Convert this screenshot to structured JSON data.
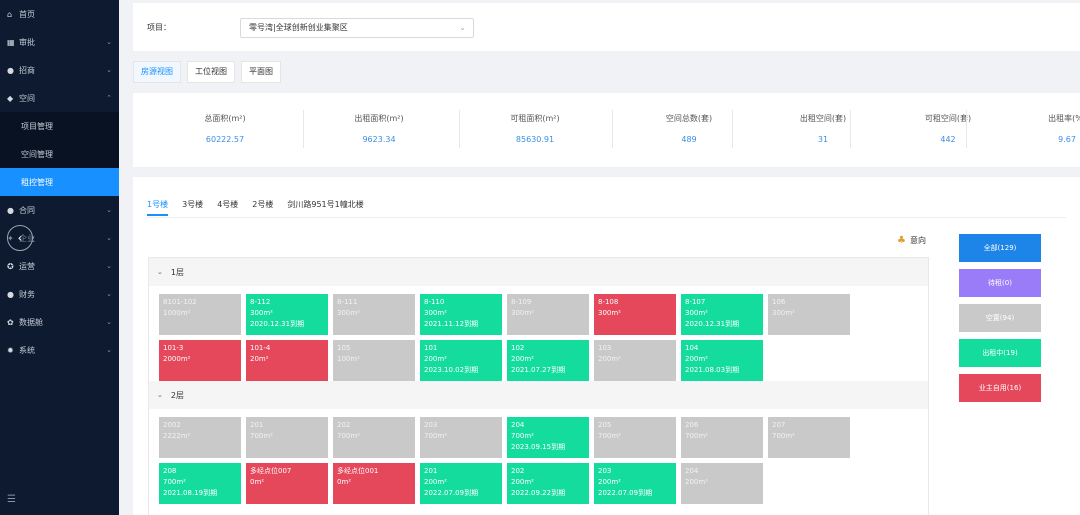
{
  "sidebar": {
    "items": [
      {
        "icon": "home-icon",
        "glyph": "⌂",
        "label": "首页",
        "chev": ""
      },
      {
        "icon": "approval-icon",
        "glyph": "▦",
        "label": "审批",
        "chev": "⌄"
      },
      {
        "icon": "person-icon",
        "glyph": "●",
        "label": "招商",
        "chev": "⌄"
      },
      {
        "icon": "cube-icon",
        "glyph": "◆",
        "label": "空间",
        "chev": "⌃"
      }
    ],
    "subitems": [
      {
        "label": "项目管理",
        "active": false
      },
      {
        "label": "空间管理",
        "active": false
      },
      {
        "label": "租控管理",
        "active": true
      }
    ],
    "items2": [
      {
        "icon": "contract-icon",
        "glyph": "●",
        "label": "合同",
        "chev": "⌄"
      },
      {
        "icon": "enterprise-icon",
        "glyph": "✦",
        "label": "企业",
        "chev": "⌄"
      },
      {
        "icon": "operation-icon",
        "glyph": "✪",
        "label": "运营",
        "chev": "⌄"
      },
      {
        "icon": "finance-icon",
        "glyph": "●",
        "label": "财务",
        "chev": "⌄"
      },
      {
        "icon": "data-icon",
        "glyph": "✿",
        "label": "数据舱",
        "chev": "⌄"
      },
      {
        "icon": "system-icon",
        "glyph": "✹",
        "label": "系统",
        "chev": "⌄"
      }
    ],
    "collapse_glyph": "‹",
    "footer_glyph": "☰"
  },
  "project": {
    "label": "项目：",
    "value": "零号湾|全球创新创业集聚区",
    "arrow": "⌄"
  },
  "view_tabs": [
    {
      "label": "房源视图",
      "active": true
    },
    {
      "label": "工位视图",
      "active": false
    },
    {
      "label": "平面图",
      "active": false
    }
  ],
  "stats": [
    {
      "title": "总面积(m²)",
      "value": "60222.57"
    },
    {
      "title": "出租面积(m²)",
      "value": "9623.34"
    },
    {
      "title": "可租面积(m²)",
      "value": "85630.91"
    },
    {
      "title": "空间总数(套)",
      "value": "489"
    },
    {
      "title": "出租空间(套)",
      "value": "31"
    },
    {
      "title": "可租空间(套)",
      "value": "442"
    },
    {
      "title": "出租率(%)",
      "value": "9.67"
    }
  ],
  "building_tabs": [
    {
      "label": "1号楼",
      "active": true
    },
    {
      "label": "3号楼",
      "active": false
    },
    {
      "label": "4号楼",
      "active": false
    },
    {
      "label": "2号楼",
      "active": false
    },
    {
      "label": "剑川路951号1幢北楼",
      "active": false
    }
  ],
  "legend": {
    "icon": "intent-icon",
    "glyph": "♣",
    "label": "意向"
  },
  "floors": [
    {
      "name": "1层",
      "toggle": "⌄",
      "rooms": [
        {
          "no": "8101-102",
          "area": "1000m²",
          "date": "",
          "status": "grey"
        },
        {
          "no": "8-112",
          "area": "300m²",
          "date": "2020.12.31到期",
          "status": "green"
        },
        {
          "no": "8-111",
          "area": "300m²",
          "date": "",
          "status": "grey"
        },
        {
          "no": "8-110",
          "area": "300m²",
          "date": "2021.11.12到期",
          "status": "green"
        },
        {
          "no": "8-109",
          "area": "300m²",
          "date": "",
          "status": "grey"
        },
        {
          "no": "8-108",
          "area": "300m²",
          "date": "",
          "status": "red"
        },
        {
          "no": "8-107",
          "area": "300m²",
          "date": "2020.12.31到期",
          "status": "green"
        },
        {
          "no": "106",
          "area": "300m²",
          "date": "",
          "status": "grey"
        },
        {
          "no": "101-3",
          "area": "2000m²",
          "date": "",
          "status": "red"
        },
        {
          "no": "101-4",
          "area": "20m²",
          "date": "",
          "status": "red"
        },
        {
          "no": "105",
          "area": "100m²",
          "date": "",
          "status": "grey"
        },
        {
          "no": "101",
          "area": "200m²",
          "date": "2023.10.02到期",
          "status": "green"
        },
        {
          "no": "102",
          "area": "200m²",
          "date": "2021.07.27到期",
          "status": "green"
        },
        {
          "no": "103",
          "area": "200m²",
          "date": "",
          "status": "grey"
        },
        {
          "no": "104",
          "area": "200m²",
          "date": "2021.08.03到期",
          "status": "green"
        }
      ]
    },
    {
      "name": "2层",
      "toggle": "⌄",
      "rooms": [
        {
          "no": "2002",
          "area": "2222m²",
          "date": "",
          "status": "grey"
        },
        {
          "no": "201",
          "area": "700m²",
          "date": "",
          "status": "grey"
        },
        {
          "no": "202",
          "area": "700m²",
          "date": "",
          "status": "grey"
        },
        {
          "no": "203",
          "area": "700m²",
          "date": "",
          "status": "grey"
        },
        {
          "no": "204",
          "area": "700m²",
          "date": "2023.09.15到期",
          "status": "green"
        },
        {
          "no": "205",
          "area": "700m²",
          "date": "",
          "status": "grey"
        },
        {
          "no": "206",
          "area": "700m²",
          "date": "",
          "status": "grey"
        },
        {
          "no": "207",
          "area": "700m²",
          "date": "",
          "status": "grey"
        },
        {
          "no": "208",
          "area": "700m²",
          "date": "2021.08.19到期",
          "status": "green"
        },
        {
          "no": "多经点位007",
          "area": "0m²",
          "date": "",
          "status": "red"
        },
        {
          "no": "多经点位001",
          "area": "0m²",
          "date": "",
          "status": "red"
        },
        {
          "no": "201",
          "area": "200m²",
          "date": "2022.07.09到期",
          "status": "green"
        },
        {
          "no": "202",
          "area": "200m²",
          "date": "2022.09.22到期",
          "status": "green"
        },
        {
          "no": "203",
          "area": "200m²",
          "date": "2022.07.09到期",
          "status": "green"
        },
        {
          "no": "204",
          "area": "200m²",
          "date": "",
          "status": "grey"
        }
      ]
    }
  ],
  "filters": [
    {
      "label": "全部(129)",
      "color": "#1d84e8"
    },
    {
      "label": "待租(0)",
      "color": "#9a7cf8"
    },
    {
      "label": "空置(94)",
      "color": "#c9c9c9"
    },
    {
      "label": "出租中(19)",
      "color": "#13dc9c"
    },
    {
      "label": "业主自用(16)",
      "color": "#e5475b"
    }
  ]
}
